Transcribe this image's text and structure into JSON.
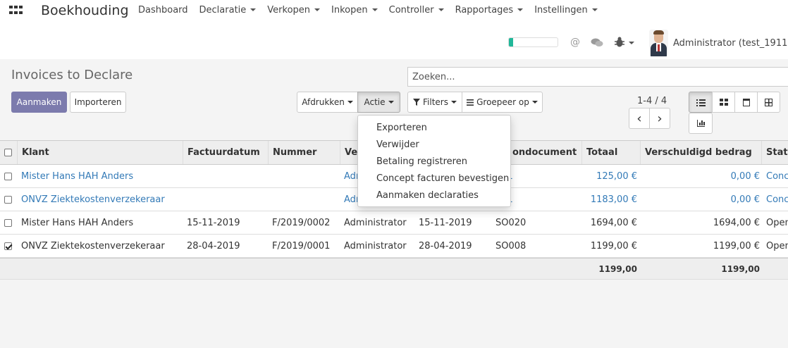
{
  "navbar": {
    "brand": "Boekhouding",
    "menu": [
      "Dashboard",
      "Declaratie",
      "Verkopen",
      "Inkopen",
      "Controller",
      "Rapportages",
      "Instellingen"
    ],
    "user": "Administrator (test_191125_",
    "progress_fraction": 0.08
  },
  "control": {
    "title": "Invoices to Declare",
    "search_placeholder": "Zoeken...",
    "create_label": "Aanmaken",
    "import_label": "Importeren",
    "print_label": "Afdrukken",
    "action_label": "Actie",
    "filters_label": "Filters",
    "groupby_label": "Groepeer op",
    "pager": "1-4 / 4",
    "pager_prev": "‹",
    "pager_next": "›"
  },
  "dropdown": {
    "items": [
      "Exporteren",
      "Verwijder",
      "Betaling registreren",
      "Concept facturen bevestigen",
      "Aanmaken declaraties"
    ]
  },
  "table": {
    "headers": [
      "Klant",
      "Factuurdatum",
      "Nummer",
      "Ver",
      "ondocument",
      "Totaal",
      "Verschuldigd bedrag",
      "Statu"
    ],
    "rows": [
      {
        "klant": "Mister Hans HAH Anders",
        "datum": "",
        "nummer": "",
        "verkoper": "Adm",
        "date2": "",
        "brondoc": "021",
        "totaal": "125,00 €",
        "verschuldigd": "0,00 €",
        "status": "Conc",
        "checked": false,
        "draft": true
      },
      {
        "klant": "ONVZ Ziektekostenverzekeraar",
        "datum": "",
        "nummer": "",
        "verkoper": "Adm",
        "date2": "",
        "brondoc": "021",
        "totaal": "1183,00 €",
        "verschuldigd": "0,00 €",
        "status": "Conc",
        "checked": false,
        "draft": true
      },
      {
        "klant": "Mister Hans HAH Anders",
        "datum": "15-11-2019",
        "nummer": "F/2019/0002",
        "verkoper": "Administrator",
        "date2": "15-11-2019",
        "brondoc": "SO020",
        "totaal": "1694,00 €",
        "verschuldigd": "1694,00 €",
        "status": "Open",
        "checked": false,
        "draft": false
      },
      {
        "klant": "ONVZ Ziektekostenverzekeraar",
        "datum": "28-04-2019",
        "nummer": "F/2019/0001",
        "verkoper": "Administrator",
        "date2": "28-04-2019",
        "brondoc": "SO008",
        "totaal": "1199,00 €",
        "verschuldigd": "1199,00 €",
        "status": "Open",
        "checked": true,
        "draft": false
      }
    ],
    "footer": {
      "totaal": "1199,00",
      "verschuldigd": "1199,00"
    }
  }
}
